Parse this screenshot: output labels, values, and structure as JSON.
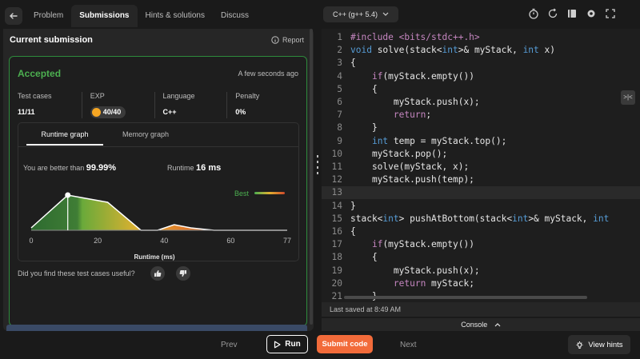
{
  "nav": {
    "tabs": [
      {
        "label": "Problem"
      },
      {
        "label": "Submissions"
      },
      {
        "label": "Hints & solutions"
      },
      {
        "label": "Discuss"
      }
    ],
    "language_selected": "C++ (g++ 5.4)"
  },
  "submission": {
    "title": "Current submission",
    "report_label": "Report",
    "status": "Accepted",
    "time_ago": "A few seconds ago",
    "stats": [
      {
        "label": "Test cases",
        "value": "11/11"
      },
      {
        "label": "EXP",
        "value": "40/40"
      },
      {
        "label": "Language",
        "value": "C++"
      },
      {
        "label": "Penalty",
        "value": "0%"
      }
    ],
    "graph_tabs": [
      "Runtime graph",
      "Memory graph"
    ],
    "better_than_label": "You are better than",
    "better_than_value": "99.99%",
    "runtime_label": "Runtime",
    "runtime_value": "16 ms",
    "useful_question": "Did you find these test cases useful?"
  },
  "chart_data": {
    "type": "area",
    "xlabel": "Runtime (ms)",
    "x_ticks": [
      "0",
      "20",
      "40",
      "60",
      "77"
    ],
    "xlim": [
      0,
      77
    ],
    "legend": "Best",
    "marker_x": 11,
    "x": [
      0,
      11,
      23,
      33,
      38,
      43,
      48,
      55,
      60,
      77
    ],
    "y": [
      3,
      44,
      35,
      0,
      0,
      7,
      3,
      0,
      0,
      0
    ]
  },
  "editor": {
    "lines": [
      {
        "n": "1",
        "tokens": [
          {
            "t": "#include <bits/stdc++.h>",
            "c": "inc"
          }
        ]
      },
      {
        "n": "2",
        "tokens": [
          {
            "t": "void",
            "c": "kw"
          },
          {
            "t": " solve(stack<",
            "c": "code-plain"
          },
          {
            "t": "int",
            "c": "kw"
          },
          {
            "t": ">& myStack, ",
            "c": "code-plain"
          },
          {
            "t": "int",
            "c": "kw"
          },
          {
            "t": " x)",
            "c": "code-plain"
          }
        ]
      },
      {
        "n": "3",
        "tokens": [
          {
            "t": "{",
            "c": "code-plain"
          }
        ]
      },
      {
        "n": "4",
        "tokens": [
          {
            "t": "    ",
            "c": "code-plain"
          },
          {
            "t": "if",
            "c": "ctl"
          },
          {
            "t": "(myStack.empty())",
            "c": "code-plain"
          }
        ]
      },
      {
        "n": "5",
        "tokens": [
          {
            "t": "    {",
            "c": "code-plain"
          }
        ]
      },
      {
        "n": "6",
        "tokens": [
          {
            "t": "        myStack.push(x);",
            "c": "code-plain"
          }
        ]
      },
      {
        "n": "7",
        "tokens": [
          {
            "t": "        ",
            "c": "code-plain"
          },
          {
            "t": "return",
            "c": "ctl"
          },
          {
            "t": ";",
            "c": "code-plain"
          }
        ]
      },
      {
        "n": "8",
        "tokens": [
          {
            "t": "    }",
            "c": "code-plain"
          }
        ]
      },
      {
        "n": "9",
        "tokens": [
          {
            "t": "    ",
            "c": "code-plain"
          },
          {
            "t": "int",
            "c": "kw"
          },
          {
            "t": " temp = myStack.top();",
            "c": "code-plain"
          }
        ]
      },
      {
        "n": "10",
        "tokens": [
          {
            "t": "    myStack.pop();",
            "c": "code-plain"
          }
        ]
      },
      {
        "n": "11",
        "tokens": [
          {
            "t": "    solve(myStack, x);",
            "c": "code-plain"
          }
        ]
      },
      {
        "n": "12",
        "tokens": [
          {
            "t": "    myStack.push(temp);",
            "c": "code-plain"
          }
        ]
      },
      {
        "n": "13",
        "tokens": [
          {
            "t": "",
            "c": "code-plain"
          }
        ],
        "highlight": true
      },
      {
        "n": "14",
        "tokens": [
          {
            "t": "}",
            "c": "code-plain"
          }
        ]
      },
      {
        "n": "15",
        "tokens": [
          {
            "t": "stack<",
            "c": "code-plain"
          },
          {
            "t": "int",
            "c": "kw"
          },
          {
            "t": "> pushAtBottom(stack<",
            "c": "code-plain"
          },
          {
            "t": "int",
            "c": "kw"
          },
          {
            "t": ">& myStack, ",
            "c": "code-plain"
          },
          {
            "t": "int",
            "c": "kw"
          }
        ]
      },
      {
        "n": "16",
        "tokens": [
          {
            "t": "{",
            "c": "code-plain"
          }
        ]
      },
      {
        "n": "17",
        "tokens": [
          {
            "t": "    ",
            "c": "code-plain"
          },
          {
            "t": "if",
            "c": "ctl"
          },
          {
            "t": "(myStack.empty())",
            "c": "code-plain"
          }
        ]
      },
      {
        "n": "18",
        "tokens": [
          {
            "t": "    {",
            "c": "code-plain"
          }
        ]
      },
      {
        "n": "19",
        "tokens": [
          {
            "t": "        myStack.push(x);",
            "c": "code-plain"
          }
        ]
      },
      {
        "n": "20",
        "tokens": [
          {
            "t": "        ",
            "c": "code-plain"
          },
          {
            "t": "return",
            "c": "ctl"
          },
          {
            "t": " myStack;",
            "c": "code-plain"
          }
        ]
      },
      {
        "n": "21",
        "tokens": [
          {
            "t": "    }",
            "c": "code-plain"
          }
        ]
      }
    ],
    "last_saved": "Last saved at 8:49 AM",
    "console_label": "Console"
  },
  "footer": {
    "prev_label": "Prev",
    "run_label": "Run",
    "submit_label": "Submit code",
    "next_label": "Next",
    "hints_label": "View hints"
  },
  "colors": {
    "accent": "#f26b3a",
    "accepted": "#4caf50",
    "keyword": "#569cd6",
    "control": "#c586c0"
  }
}
